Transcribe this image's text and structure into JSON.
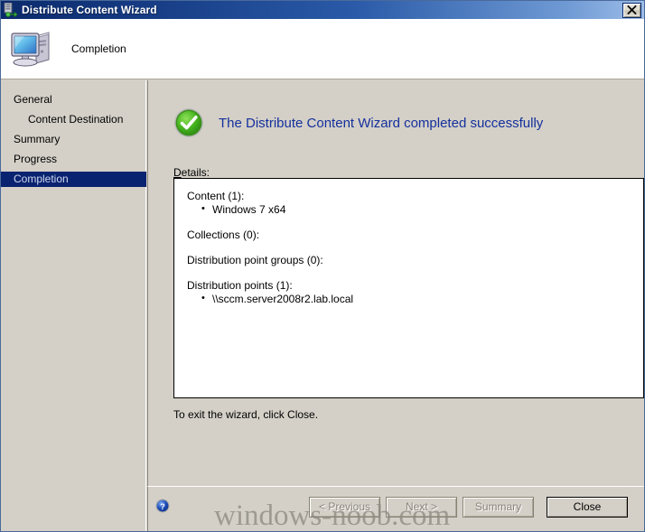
{
  "window": {
    "title": "Distribute Content Wizard",
    "title_icon": "distribute-content-icon",
    "close_icon": "close-icon"
  },
  "header": {
    "icon": "computer-icon",
    "label": "Completion"
  },
  "sidebar": {
    "items": [
      {
        "label": "General",
        "sub": false,
        "selected": false
      },
      {
        "label": "Content Destination",
        "sub": true,
        "selected": false
      },
      {
        "label": "Summary",
        "sub": false,
        "selected": false
      },
      {
        "label": "Progress",
        "sub": false,
        "selected": false
      },
      {
        "label": "Completion",
        "sub": false,
        "selected": true
      }
    ]
  },
  "main": {
    "status_icon": "success-check-icon",
    "heading": "The Distribute Content Wizard completed successfully",
    "heading_color": "#14309c",
    "details_label": "Details:",
    "details_label_accel": "D",
    "details_label_rest": "etails:",
    "details": [
      {
        "title": "Content (1):",
        "bullets": [
          "Windows 7 x64"
        ]
      },
      {
        "title": "Collections (0):",
        "bullets": []
      },
      {
        "title": "Distribution point groups (0):",
        "bullets": []
      },
      {
        "title": "Distribution points (1):",
        "bullets": [
          "\\\\sccm.server2008r2.lab.local"
        ]
      }
    ],
    "exit_note": "To exit the wizard, click Close."
  },
  "footer": {
    "help_icon": "help-icon",
    "buttons": [
      {
        "label": "< Previous",
        "accel": "P",
        "disabled": true,
        "default": false
      },
      {
        "label": "Next >",
        "accel": "N",
        "disabled": true,
        "default": false
      },
      {
        "label": "Summary",
        "accel": "S",
        "disabled": true,
        "default": false
      },
      {
        "label": "Close",
        "accel": "",
        "disabled": false,
        "default": true
      }
    ]
  },
  "watermark": {
    "text": "windows-noob.com"
  }
}
